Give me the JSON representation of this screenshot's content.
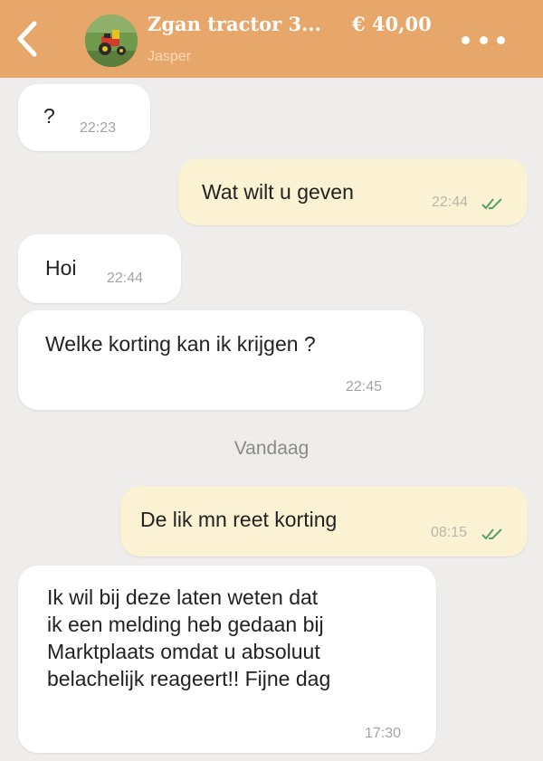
{
  "header": {
    "back_icon": "chevron-left-icon",
    "title": "Zgan tractor 3...",
    "price": "€ 40,00",
    "subtitle": "Jasper",
    "more_icon": "more-horizontal-icon",
    "background_color": "#e8a76a"
  },
  "messages": [
    {
      "direction": "in",
      "text": "?",
      "time": "22:23"
    },
    {
      "direction": "out",
      "text": "Wat wilt u geven",
      "time": "22:44",
      "read_icon": "double-check-icon"
    },
    {
      "direction": "in",
      "text": "Hoi",
      "time": "22:44"
    },
    {
      "direction": "in",
      "text": "Welke korting kan ik krijgen ?",
      "time": "22:45"
    },
    {
      "direction": "out",
      "text": "De lik mn reet korting",
      "time": "08:15",
      "read_icon": "double-check-icon"
    },
    {
      "direction": "in",
      "lines": [
        "Ik wil bij deze laten weten dat",
        "ik een melding heb gedaan bij",
        "Marktplaats omdat u absoluut",
        "belachelijk reageert!! Fijne dag"
      ],
      "time": "17:30"
    }
  ],
  "day_separator": "Vandaag",
  "colors": {
    "incoming_bubble": "#ffffff",
    "outgoing_bubble": "#fbf1d3",
    "read_check": "#5a9e6f",
    "chat_background": "#eeedeb"
  }
}
